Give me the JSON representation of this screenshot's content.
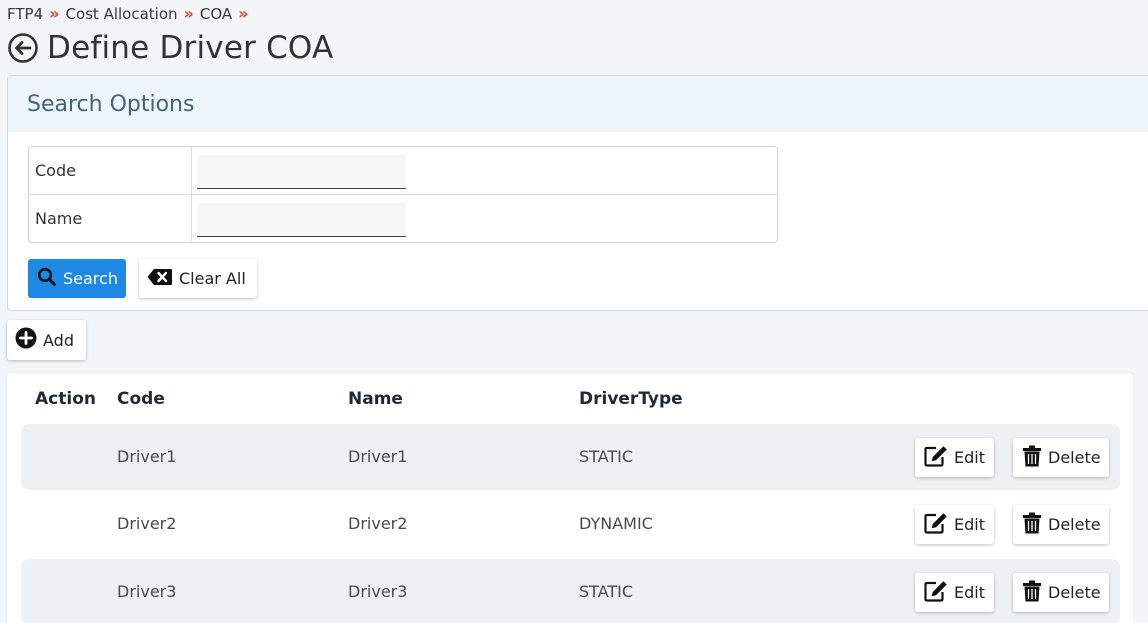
{
  "breadcrumb": {
    "items": [
      "FTP4",
      "Cost Allocation",
      "COA"
    ],
    "separator": "»"
  },
  "page": {
    "title": "Define Driver COA"
  },
  "search": {
    "header": "Search Options",
    "fields": [
      {
        "label": "Code",
        "value": ""
      },
      {
        "label": "Name",
        "value": ""
      }
    ],
    "search_label": "Search",
    "clear_label": "Clear All"
  },
  "toolbar": {
    "add_label": "Add"
  },
  "table": {
    "headers": [
      "Action",
      "Code",
      "Name",
      "DriverType"
    ],
    "rows": [
      {
        "code": "Driver1",
        "name": "Driver1",
        "driver_type": "STATIC",
        "edit_label": "Edit",
        "delete_label": "Delete"
      },
      {
        "code": "Driver2",
        "name": "Driver2",
        "driver_type": "DYNAMIC",
        "edit_label": "Edit",
        "delete_label": "Delete"
      },
      {
        "code": "Driver3",
        "name": "Driver3",
        "driver_type": "STATIC",
        "edit_label": "Edit",
        "delete_label": "Delete"
      }
    ]
  },
  "colors": {
    "primary": "#1e88e5",
    "breadcrumb_separator": "#d9442a",
    "search_header_text": "#3d6680",
    "shaded_row": "#eff0f4"
  },
  "icons": {
    "back": "arrow-left-circle-icon",
    "search": "magnifier-icon",
    "clear": "backspace-x-icon",
    "add": "plus-circle-icon",
    "edit": "pencil-square-icon",
    "delete": "trash-icon"
  }
}
